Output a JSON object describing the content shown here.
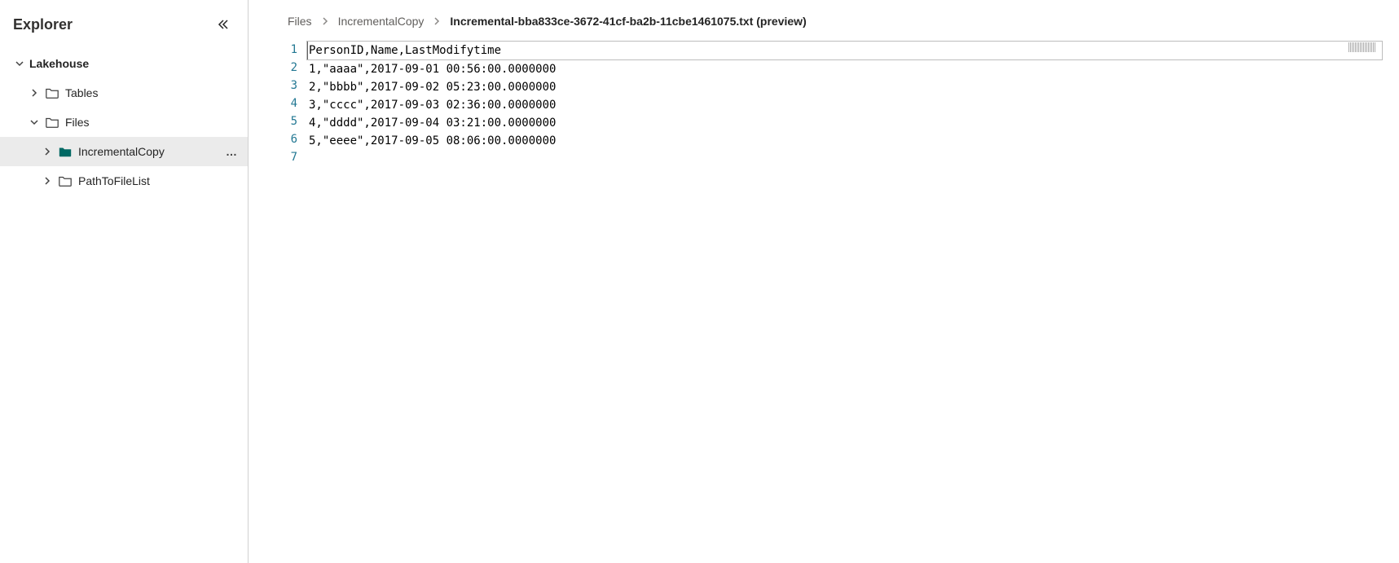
{
  "sidebar": {
    "title": "Explorer",
    "root": {
      "label": "Lakehouse",
      "expanded": true,
      "children": [
        {
          "label": "Tables",
          "expanded": false,
          "icon": "folder-outline"
        },
        {
          "label": "Files",
          "expanded": true,
          "icon": "folder-outline",
          "children": [
            {
              "label": "IncrementalCopy",
              "expanded": false,
              "icon": "folder-solid",
              "selected": true,
              "more": true
            },
            {
              "label": "PathToFileList",
              "expanded": false,
              "icon": "folder-outline"
            }
          ]
        }
      ]
    }
  },
  "breadcrumb": {
    "items": [
      {
        "label": "Files",
        "active": false
      },
      {
        "label": "IncrementalCopy",
        "active": false
      },
      {
        "label": "Incremental-bba833ce-3672-41cf-ba2b-11cbe1461075.txt (preview)",
        "active": true
      }
    ]
  },
  "editor": {
    "lineNumbers": [
      "1",
      "2",
      "3",
      "4",
      "5",
      "6",
      "7"
    ],
    "lines": [
      "PersonID,Name,LastModifytime",
      "1,\"aaaa\",2017-09-01 00:56:00.0000000",
      "2,\"bbbb\",2017-09-02 05:23:00.0000000",
      "3,\"cccc\",2017-09-03 02:36:00.0000000",
      "4,\"dddd\",2017-09-04 03:21:00.0000000",
      "5,\"eeee\",2017-09-05 08:06:00.0000000",
      ""
    ]
  }
}
